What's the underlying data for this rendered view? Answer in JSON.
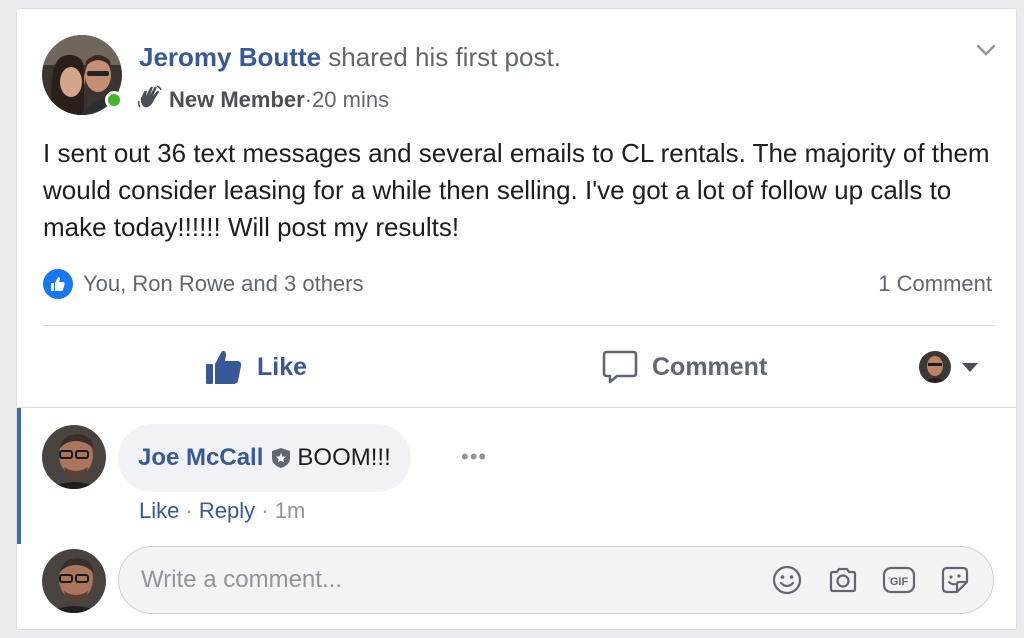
{
  "post": {
    "author": "Jeromy Boutte",
    "action_text": " shared his first post.",
    "badge": "New Member",
    "time_separator": " · ",
    "time": "20 mins",
    "body": "I sent out 36 text messages and several emails to CL rentals. The majority of them would consider leasing for a while then selling. I've got a lot of follow up calls to make today!!!!!! Will post my results!",
    "reactions_text": "You, Ron Rowe and 3 others",
    "comment_count": "1 Comment"
  },
  "actions": {
    "like": "Like",
    "comment": "Comment"
  },
  "comment": {
    "author": "Joe McCall",
    "text": "BOOM!!!",
    "more": "•••",
    "like": "Like",
    "sep1": " · ",
    "reply": "Reply",
    "sep2": " · ",
    "time": "1m"
  },
  "reply_box": {
    "placeholder": "Write a comment..."
  },
  "colors": {
    "link_blue": "#385898",
    "like_blue": "#1877f2",
    "online_green": "#42b72a",
    "thread_bar": "#4267b2"
  },
  "icons": {
    "badge": "waving-hand-icon",
    "chevron": "chevron-down-icon",
    "reaction": "thumbs-up-icon",
    "admin": "shield-star-icon",
    "reply_tools": [
      "smiley-icon",
      "camera-icon",
      "gif-icon",
      "sticker-icon"
    ]
  }
}
